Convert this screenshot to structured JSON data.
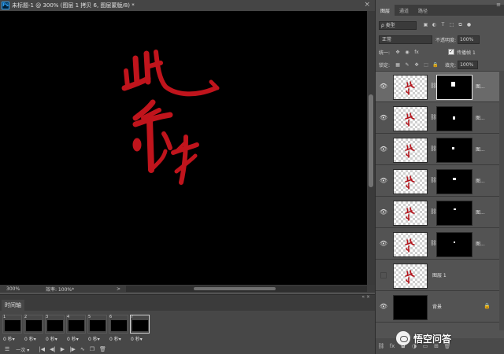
{
  "document": {
    "app_badge": "Ps",
    "title": "未标题-1 @ 300% (图层 1 拷贝 6, 图层蒙版/8) *",
    "close_label": "×",
    "zoom": "300%",
    "efficiency": "效率: 100%*",
    "status_arrow": ">"
  },
  "timeline": {
    "tab_label": "时间轴",
    "collapse_label": "« ×",
    "frames": [
      {
        "num": "1",
        "delay": "0 秒"
      },
      {
        "num": "2",
        "delay": "0 秒"
      },
      {
        "num": "3",
        "delay": "0 秒"
      },
      {
        "num": "4",
        "delay": "0 秒"
      },
      {
        "num": "5",
        "delay": "0 秒"
      },
      {
        "num": "6",
        "delay": "0 秒"
      },
      {
        "num": "7",
        "delay": "0 秒"
      }
    ],
    "selected_frame": 7,
    "loop_option": "一次"
  },
  "layers_panel": {
    "tabs": [
      "图层",
      "通道",
      "路径"
    ],
    "menu_label": "≡",
    "filter_type": "ρ 类型",
    "blend_mode": "正常",
    "opacity_label": "不透明度:",
    "opacity_value": "100%",
    "unify_label": "统一:",
    "propagate_label": "传播帧 1",
    "lock_label": "锁定:",
    "fill_label": "填充:",
    "fill_value": "100%",
    "layers": [
      {
        "name": "图...",
        "has_mask": true,
        "selected": true
      },
      {
        "name": "图...",
        "has_mask": true,
        "selected": false
      },
      {
        "name": "图...",
        "has_mask": true,
        "selected": false
      },
      {
        "name": "图...",
        "has_mask": true,
        "selected": false
      },
      {
        "name": "图...",
        "has_mask": true,
        "selected": false
      },
      {
        "name": "图...",
        "has_mask": true,
        "selected": false
      },
      {
        "name": "图层 1",
        "has_mask": false,
        "selected": false
      },
      {
        "name": "背景",
        "has_mask": false,
        "selected": false
      }
    ]
  },
  "watermark": {
    "text": "悟空问答"
  },
  "colors": {
    "brush_red": "#c0141c",
    "ps_blue": "#31a8ff"
  }
}
